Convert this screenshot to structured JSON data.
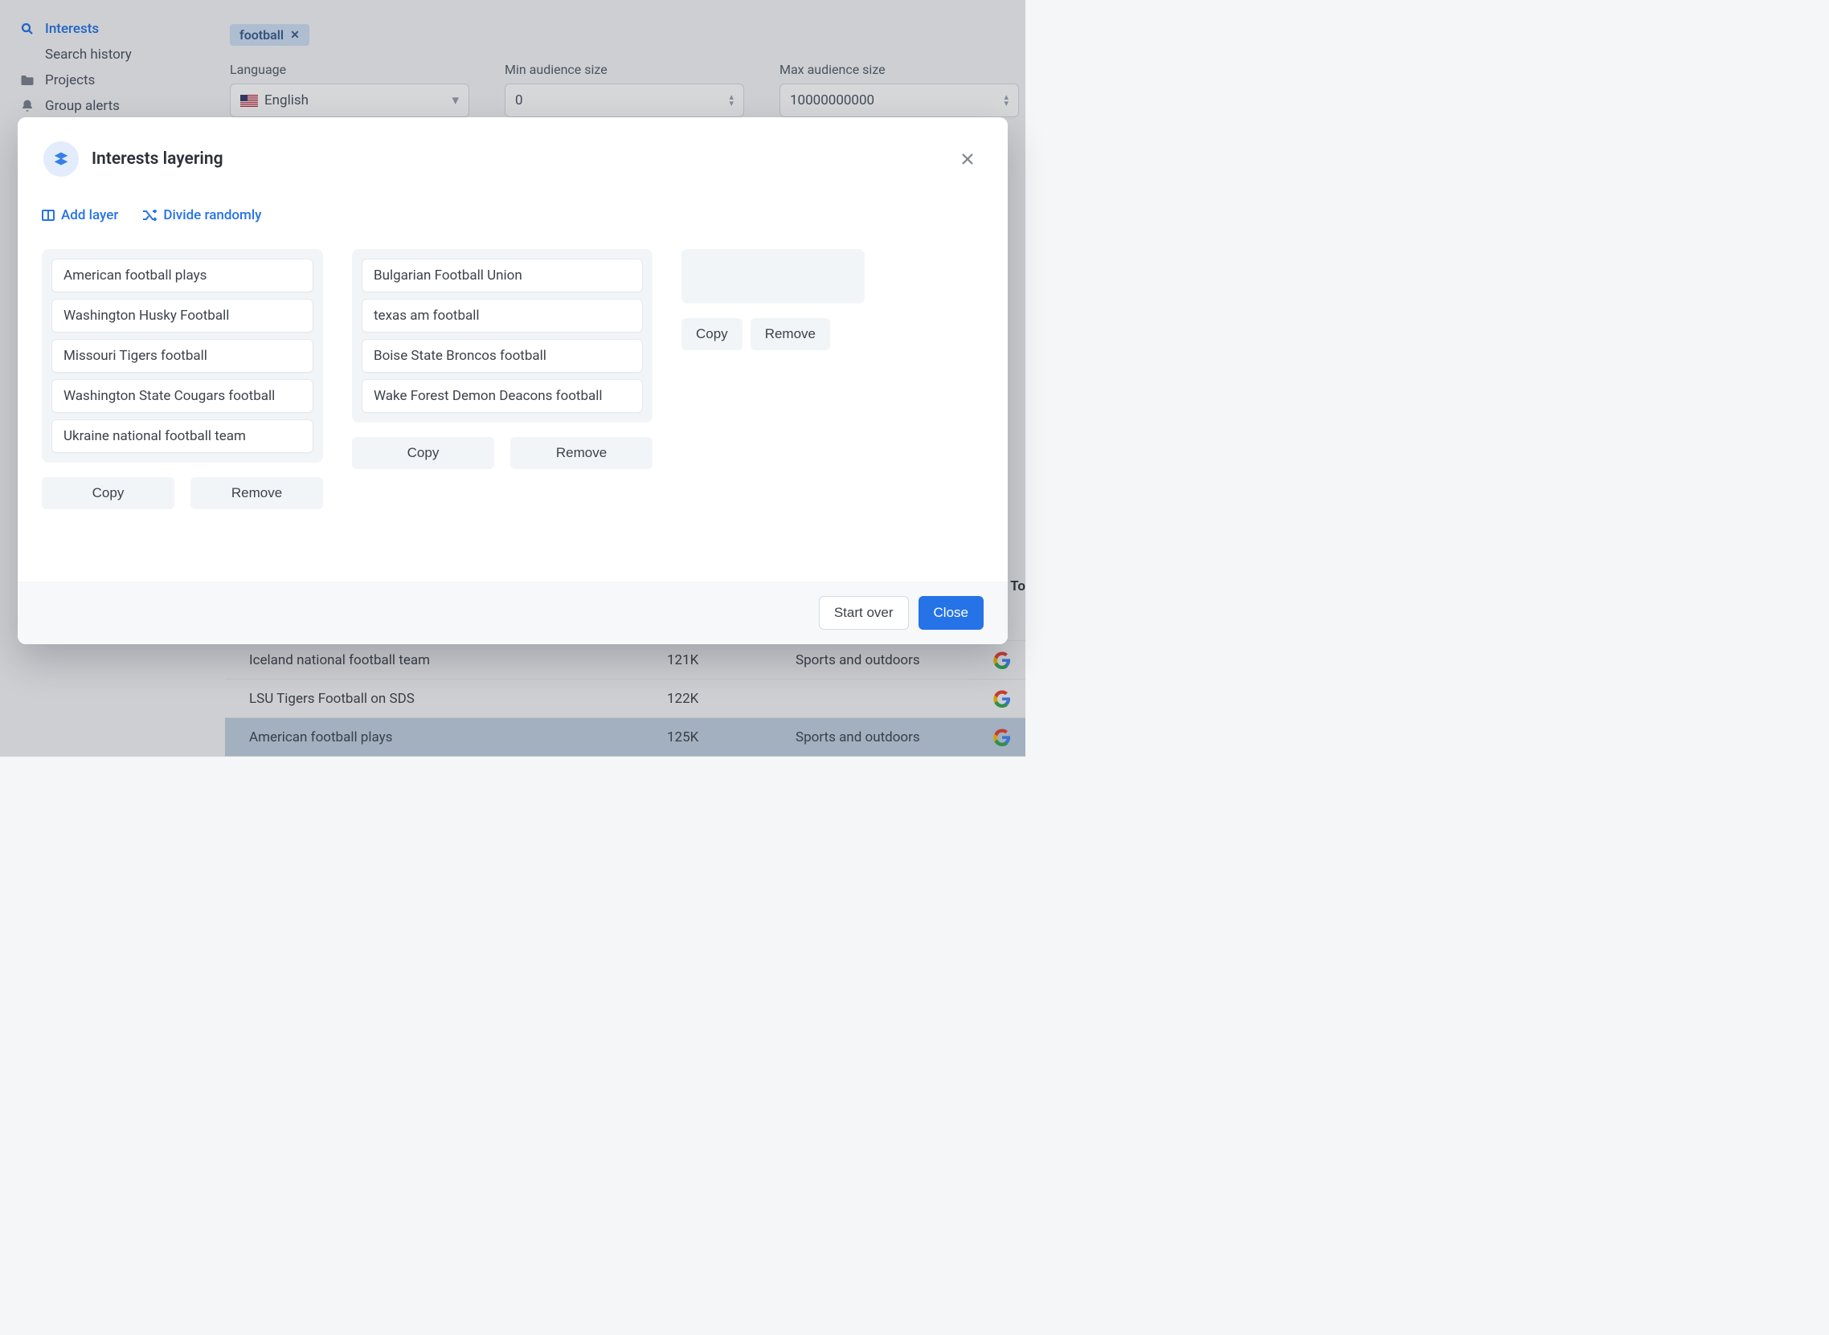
{
  "sidebar": {
    "items": [
      {
        "label": "Interests",
        "icon": "search",
        "active": true
      },
      {
        "label": "Search history",
        "sub": true
      },
      {
        "label": "Projects",
        "icon": "folder"
      },
      {
        "label": "Group alerts",
        "icon": "bell"
      }
    ]
  },
  "tag": {
    "label": "football"
  },
  "filters": {
    "language": {
      "label": "Language",
      "value": "English"
    },
    "min": {
      "label": "Min audience size",
      "value": "0"
    },
    "max": {
      "label": "Max audience size",
      "value": "10000000000"
    }
  },
  "modal": {
    "title": "Interests layering",
    "add_layer": "Add layer",
    "divide": "Divide randomly",
    "copy": "Copy",
    "remove": "Remove",
    "start_over": "Start over",
    "close": "Close",
    "layers": [
      [
        "American football plays",
        "Washington Husky Football",
        "Missouri Tigers football",
        "Washington State Cougars football",
        "Ukraine national football team"
      ],
      [
        "Bulgarian Football Union",
        "texas am football",
        "Boise State Broncos football",
        "Wake Forest Demon Deacons football"
      ],
      []
    ]
  },
  "table": {
    "totals": "To",
    "rows": [
      {
        "name": "Iceland national football team",
        "aud": "121K",
        "cat": "Sports and outdoors",
        "highlight": false
      },
      {
        "name": "LSU Tigers Football on SDS",
        "aud": "122K",
        "cat": "",
        "highlight": false
      },
      {
        "name": "American football plays",
        "aud": "125K",
        "cat": "Sports and outdoors",
        "highlight": true
      }
    ]
  }
}
